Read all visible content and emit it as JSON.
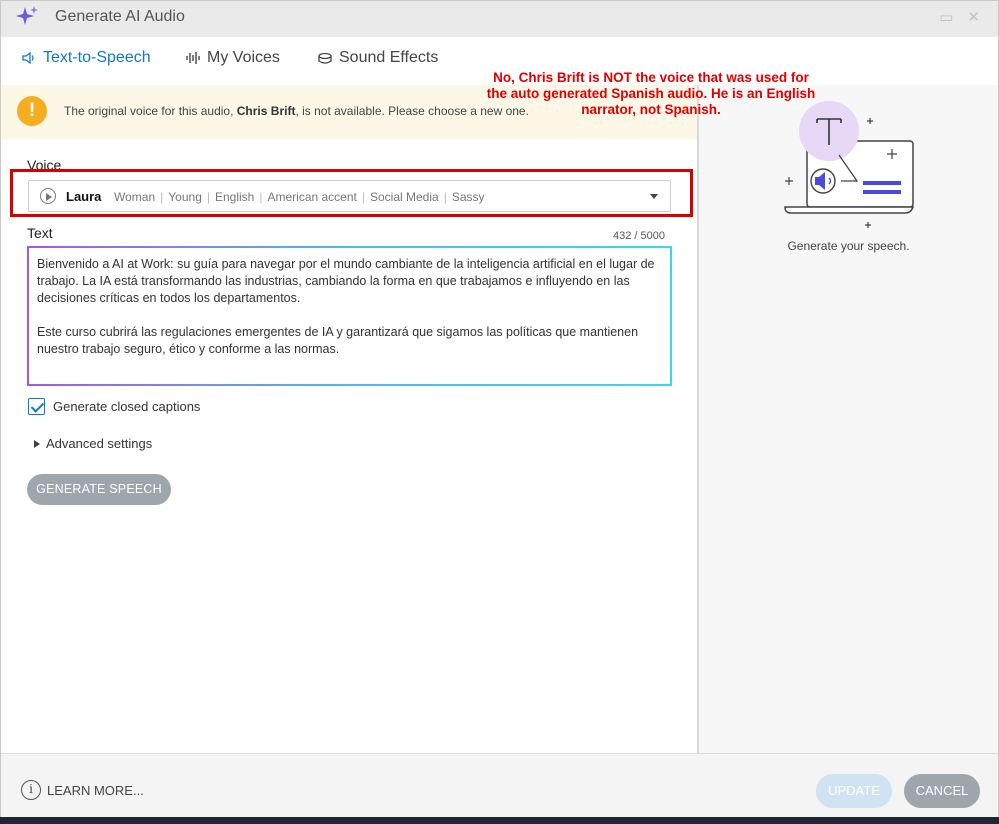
{
  "window": {
    "title": "Generate AI Audio",
    "minimize_glyph": "▭",
    "close_glyph": "✕"
  },
  "tabs": [
    {
      "label": "Text-to-Speech",
      "icon": "speaker-icon",
      "active": true
    },
    {
      "label": "My Voices",
      "icon": "waveform-icon",
      "active": false
    },
    {
      "label": "Sound Effects",
      "icon": "drum-icon",
      "active": false
    }
  ],
  "warning": {
    "icon_glyph": "!",
    "text_before": "The original voice for this audio, ",
    "voice_name": "Chris Brift",
    "text_after": ", is not available. Please choose a new one."
  },
  "annotation": {
    "line1": "No, Chris Brift is NOT the voice that was used for",
    "line2": "the auto generated Spanish audio. He is an English",
    "line3": "narrator, not Spanish."
  },
  "voice": {
    "label": "Voice",
    "name": "Laura",
    "tags": [
      "Woman",
      "Young",
      "English",
      "American accent",
      "Social Media",
      "Sassy"
    ]
  },
  "text": {
    "label": "Text",
    "counter": "432 / 5000",
    "paragraph1": "Bienvenido a AI at Work: su guía para navegar por el mundo cambiante de la inteligencia artificial en el lugar de trabajo. La IA está transformando las industrias, cambiando la forma en que trabajamos e influyendo en las decisiones críticas en todos los departamentos.",
    "paragraph2": "Este curso cubrirá las regulaciones emergentes de IA y garantizará que sigamos las políticas que mantienen nuestro trabajo seguro, ético y conforme a las normas."
  },
  "options": {
    "captions_label": "Generate closed captions",
    "captions_checked": true,
    "advanced_label": "Advanced settings"
  },
  "generate_button": "GENERATE SPEECH",
  "illustration": {
    "caption": "Generate your speech.",
    "letter": "T"
  },
  "footer": {
    "learn_more": "LEARN MORE...",
    "info_glyph": "i",
    "update": "UPDATE",
    "cancel": "CANCEL"
  },
  "colors": {
    "accent": "#1478c8",
    "warning": "#f5ae1f",
    "annotation": "#e00000",
    "button_disabled": "#9ea5ab"
  }
}
